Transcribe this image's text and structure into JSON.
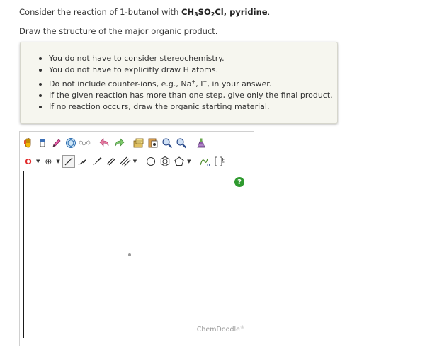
{
  "question": {
    "prefix": "Consider the reaction of 1-butanol with ",
    "reagent": "CH3SO2Cl, pyridine",
    "reagent_parts": [
      "CH",
      "3",
      "SO",
      "2",
      "Cl, pyridine"
    ],
    "period": ".",
    "instruction": "Draw the structure of the major organic product."
  },
  "notes": [
    "You do not have to consider stereochemistry.",
    "You do not have to explicitly draw H atoms.",
    "Do not include counter-ions, e.g., Na+, I-, in your answer.",
    "If the given reaction has more than one step, give only the final product.",
    "If no reaction occurs, draw the organic starting material."
  ],
  "note3_parts": {
    "pre": "Do not include counter-ions, e.g., Na",
    "sup1": "+",
    "mid": ", I",
    "sup2": "−",
    "post": ", in your answer."
  },
  "toolbar": {
    "row1_icons": [
      "hand-icon",
      "eraser-icon",
      "pencil-icon",
      "ring-template-icon",
      "chain-template-icon",
      "undo-icon",
      "redo-icon",
      "copy-icon",
      "paste-icon",
      "zoom-in-icon",
      "zoom-out-icon",
      "clean-icon"
    ],
    "element_label": "O",
    "charge_label": "⊕"
  },
  "canvas": {
    "help_label": "?",
    "brand": "ChemDoodle",
    "brand_mark": "®"
  },
  "colors": {
    "help": "#2f9a2f",
    "canvas_border": "#1a1a1a",
    "panel_bg": "#f6f6ef"
  }
}
